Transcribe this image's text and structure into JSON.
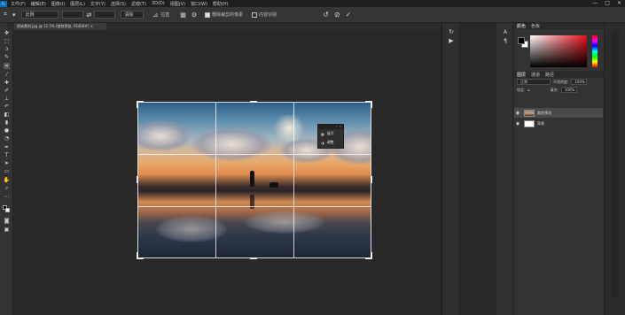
{
  "app": {
    "logo": "Ps"
  },
  "menubar": {
    "items": [
      "文件(F)",
      "编辑(E)",
      "图像(I)",
      "图层(L)",
      "文字(Y)",
      "选择(S)",
      "滤镜(T)",
      "3D(D)",
      "视图(V)",
      "窗口(W)",
      "帮助(H)"
    ],
    "window_controls": [
      "—",
      "□",
      "✕"
    ]
  },
  "options": {
    "preset": "比例",
    "clear_button": "清除",
    "straighten_label": "拉直",
    "delete_cropped_label": "删除裁剪的像素",
    "content_aware_label": "内容识别",
    "reset_icon": "↺",
    "cancel_icon": "⊘",
    "commit_icon": "✓"
  },
  "document": {
    "tab_title": "原始素材.jpg @ 12.5% (裁剪预览, RGB/8#) ×"
  },
  "crop_panel": {
    "items": [
      {
        "label": "展开",
        "icon": "grid-icon"
      },
      {
        "label": "调整",
        "icon": "adjust-icon"
      }
    ]
  },
  "color_panel": {
    "tabs": [
      "颜色",
      "色板"
    ],
    "foreground": "#000000",
    "background": "#ffffff",
    "picker_hue": "#e31019"
  },
  "layers_panel": {
    "tabs": [
      "图层",
      "通道",
      "路径"
    ],
    "blend_mode": "正常",
    "opacity_label": "不透明度:",
    "opacity_value": "100%",
    "lock_label": "锁定:",
    "fill_label": "填充:",
    "fill_value": "100%",
    "layers": [
      {
        "name": "裁剪预览",
        "visible": true,
        "selected": true
      },
      {
        "name": "背景",
        "visible": true,
        "selected": false
      }
    ]
  },
  "colors": {
    "accent": "#0b6fb8",
    "panel_bg": "#333333",
    "canvas_bg": "#282828"
  }
}
